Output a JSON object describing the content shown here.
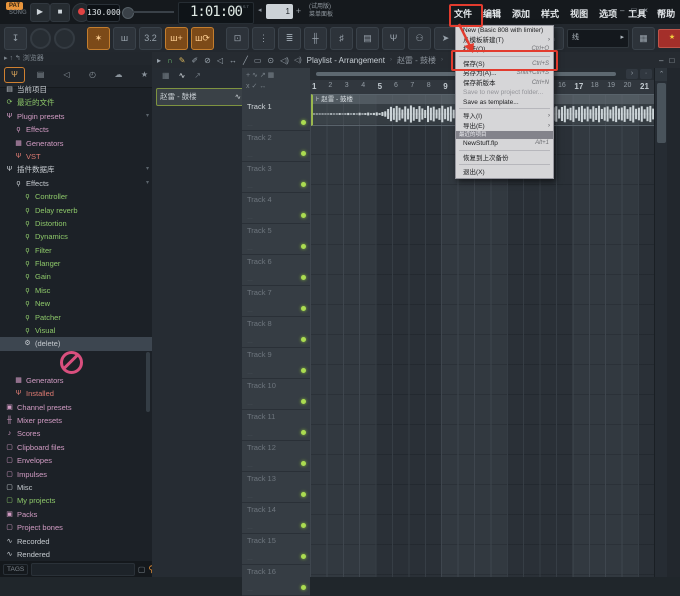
{
  "transport": {
    "mode_pat": "PAT",
    "mode_song": "SONG",
    "play_icon": "▶",
    "stop_icon": "■",
    "tempo": "130.000",
    "time": "1:01:00",
    "time_unit": "BST",
    "pattern_prev": "◂",
    "pattern_number": "1",
    "pattern_plus": "+",
    "trial_line1": "(试用版)",
    "trial_line2": "菜单面板"
  },
  "menubar": {
    "items": [
      "文件",
      "编辑",
      "添加",
      "样式",
      "视图",
      "选项",
      "工具",
      "帮助"
    ]
  },
  "window_controls": [
    "‒",
    "□",
    "×"
  ],
  "toolbar2": {
    "left_buttons": [
      {
        "name": "typing-keyboard-icon",
        "glyph": "↧"
      },
      {
        "name": "main-volume-knob",
        "knob": true
      },
      {
        "name": "main-pitch-knob",
        "knob": true
      },
      {
        "name": "metronome-icon",
        "glyph": "✶",
        "active": true
      },
      {
        "name": "wait-for-input-icon",
        "glyph": "ш"
      },
      {
        "name": "countdown-icon",
        "glyph": "3.2"
      },
      {
        "name": "blend-recording-icon",
        "glyph": "ш+",
        "active": true
      },
      {
        "name": "loop-recording-icon",
        "glyph": "ш⟳",
        "active": true
      },
      {
        "name": "step-edit-icon",
        "glyph": "⊡"
      },
      {
        "name": "piano-roll-icon",
        "glyph": "⋮"
      },
      {
        "name": "playlist-icon",
        "glyph": "≣"
      },
      {
        "name": "mixer-icon",
        "glyph": "╫"
      },
      {
        "name": "channel-rack-icon",
        "glyph": "♯"
      },
      {
        "name": "browser-icon",
        "glyph": "▤"
      },
      {
        "name": "plugin-picker-icon",
        "glyph": "Ψ"
      },
      {
        "name": "touch-icon",
        "glyph": "⚇"
      },
      {
        "name": "one-click-rec-icon",
        "glyph": "➤"
      },
      {
        "name": "undo-icon",
        "glyph": "↺"
      },
      {
        "name": "save-icon",
        "glyph": "◫"
      }
    ],
    "right": {
      "help_glyph": "?",
      "headphone_glyph": "∩",
      "line_label": "线",
      "line_arrow": "▸",
      "keyboard_glyph": "▦",
      "flag_glyph": "★",
      "arrow": "▸"
    }
  },
  "browser": {
    "header": "浏览器",
    "header_nav": "▸ ↑ ↰",
    "tabs": [
      {
        "name": "tab-plugins",
        "glyph": "Ψ",
        "active": true
      },
      {
        "name": "tab-files",
        "glyph": "▤"
      },
      {
        "name": "tab-audio",
        "glyph": "◁"
      },
      {
        "name": "tab-recent",
        "glyph": "◴"
      },
      {
        "name": "tab-cloud",
        "glyph": "☁"
      },
      {
        "name": "tab-favorites",
        "glyph": "★"
      }
    ],
    "items": [
      {
        "label": "当前项目",
        "color": "white",
        "icon": "file",
        "indent": 0
      },
      {
        "label": "最近的文件",
        "color": "green",
        "icon": "recycle",
        "indent": 0
      },
      {
        "label": "Plugin presets",
        "color": "pink",
        "icon": "plug",
        "indent": 0,
        "caret": true
      },
      {
        "label": "Effects",
        "color": "pink",
        "icon": "bulb",
        "indent": 1
      },
      {
        "label": "Generators",
        "color": "pink",
        "icon": "keys",
        "indent": 1
      },
      {
        "label": "VST",
        "color": "red",
        "icon": "plug",
        "indent": 1
      },
      {
        "label": "插件数据库",
        "color": "white",
        "icon": "plug",
        "indent": 0,
        "caret": true
      },
      {
        "label": "Effects",
        "color": "white",
        "icon": "bulb",
        "indent": 1,
        "caret": true
      },
      {
        "label": "Controller",
        "color": "green",
        "icon": "bulb",
        "indent": 2
      },
      {
        "label": "Delay reverb",
        "color": "green",
        "icon": "bulb",
        "indent": 2
      },
      {
        "label": "Distortion",
        "color": "green",
        "icon": "bulb",
        "indent": 2
      },
      {
        "label": "Dynamics",
        "color": "green",
        "icon": "bulb",
        "indent": 2
      },
      {
        "label": "Filter",
        "color": "green",
        "icon": "bulb",
        "indent": 2
      },
      {
        "label": "Flanger",
        "color": "green",
        "icon": "bulb",
        "indent": 2
      },
      {
        "label": "Gain",
        "color": "green",
        "icon": "bulb",
        "indent": 2
      },
      {
        "label": "Misc",
        "color": "green",
        "icon": "bulb",
        "indent": 2
      },
      {
        "label": "New",
        "color": "green",
        "icon": "bulb",
        "indent": 2
      },
      {
        "label": "Patcher",
        "color": "green",
        "icon": "bulb",
        "indent": 2
      },
      {
        "label": "Visual",
        "color": "green",
        "icon": "bulb",
        "indent": 2
      },
      {
        "label": "(delete)",
        "color": "white",
        "icon": "gear",
        "indent": 2,
        "selected": true,
        "nodrop": true
      },
      {
        "label": "Generators",
        "color": "pink",
        "icon": "keys",
        "indent": 1
      },
      {
        "label": "Installed",
        "color": "red",
        "icon": "plug",
        "indent": 1
      },
      {
        "label": "Channel presets",
        "color": "pink",
        "icon": "box",
        "indent": 0
      },
      {
        "label": "Mixer presets",
        "color": "pink",
        "icon": "mixer",
        "indent": 0
      },
      {
        "label": "Scores",
        "color": "pink",
        "icon": "note",
        "indent": 0
      },
      {
        "label": "Clipboard files",
        "color": "pink",
        "icon": "folder",
        "indent": 0
      },
      {
        "label": "Envelopes",
        "color": "pink",
        "icon": "folder",
        "indent": 0
      },
      {
        "label": "Impulses",
        "color": "pink",
        "icon": "folder",
        "indent": 0
      },
      {
        "label": "Misc",
        "color": "white",
        "icon": "folder",
        "indent": 0
      },
      {
        "label": "My projects",
        "color": "green",
        "icon": "folder",
        "indent": 0
      },
      {
        "label": "Packs",
        "color": "pink",
        "icon": "box",
        "indent": 0
      },
      {
        "label": "Project bones",
        "color": "pink",
        "icon": "folder",
        "indent": 0
      },
      {
        "label": "Recorded",
        "color": "white",
        "icon": "wave",
        "indent": 0
      },
      {
        "label": "Rendered",
        "color": "white",
        "icon": "wave",
        "indent": 0
      }
    ],
    "icon_glyphs": {
      "file": "▤",
      "recycle": "⟳",
      "plug": "Ψ",
      "bulb": "ϙ",
      "keys": "▦",
      "gear": "⚙",
      "box": "▣",
      "mixer": "╫",
      "note": "♪",
      "folder": "▢",
      "wave": "∿"
    },
    "tags_label": "TAGS"
  },
  "playlist": {
    "toolbar_icons": [
      {
        "name": "play-icon",
        "glyph": "▸"
      },
      {
        "name": "magnet-icon",
        "glyph": "∩",
        "color": "#6fbf73"
      },
      {
        "name": "pencil-icon",
        "glyph": "✎",
        "color": "#d8b45a"
      },
      {
        "name": "paint-icon",
        "glyph": "✐"
      },
      {
        "name": "delete-icon",
        "glyph": "⊘"
      },
      {
        "name": "mute-icon",
        "glyph": "◁"
      },
      {
        "name": "slip-icon",
        "glyph": "↔"
      },
      {
        "name": "slice-icon",
        "glyph": "╱"
      },
      {
        "name": "select-icon",
        "glyph": "▭"
      },
      {
        "name": "zoom-icon",
        "glyph": "⊙"
      },
      {
        "name": "preview-icon",
        "glyph": "◁)"
      }
    ],
    "breadcrumb_main": "Playlist - Arrangement",
    "breadcrumb_sep": "›",
    "breadcrumb_song": "赵雷 - 鼓楼",
    "window_controls": [
      "‒",
      "□",
      "×"
    ],
    "picker_tabs": [
      {
        "name": "picker-tab-patterns",
        "glyph": "▦"
      },
      {
        "name": "picker-tab-audio",
        "glyph": "∿",
        "active": true
      },
      {
        "name": "picker-tab-automation",
        "glyph": "↗"
      }
    ],
    "picker_clip": "赵雷 - 鼓楼",
    "picker_clip_icon": "∿",
    "header_tools_row1": "+  ∿ ↗ ▦",
    "header_tools_row2": "x ✓ ↔",
    "scroll_left": "‹",
    "scroll_right": "›",
    "scroll_up": "⌃",
    "tracks": [
      "Track 1",
      "Track 2",
      "Track 3",
      "Track 4",
      "Track 5",
      "Track 6",
      "Track 7",
      "Track 8",
      "Track 9",
      "Track 10",
      "Track 11",
      "Track 12",
      "Track 13",
      "Track 14",
      "Track 15",
      "Track 16"
    ],
    "ruler_bars": 22,
    "clip_name": "赵雷 - 鼓楼",
    "waveform": [
      0.05,
      0.03,
      0.04,
      0.06,
      0.03,
      0.05,
      0.08,
      0.04,
      0.06,
      0.1,
      0.05,
      0.07,
      0.12,
      0.06,
      0.09,
      0.05,
      0.14,
      0.07,
      0.1,
      0.16,
      0.08,
      0.12,
      0.18,
      0.1,
      0.22,
      0.3,
      0.55,
      0.8,
      0.65,
      0.9,
      0.7,
      0.5,
      0.85,
      0.6,
      0.95,
      0.75,
      0.55,
      0.88,
      0.62,
      0.45,
      0.9,
      0.7,
      0.82,
      0.5,
      0.65,
      0.92,
      0.58,
      0.75,
      0.85,
      0.48,
      0.7,
      0.95,
      0.6,
      0.8,
      0.52,
      0.88,
      0.66,
      0.74,
      0.9,
      0.55,
      0.68,
      0.85,
      0.5,
      0.78,
      0.92,
      0.6,
      0.72,
      0.48,
      0.86,
      0.64,
      0.9,
      0.56,
      0.76,
      0.88,
      0.52,
      0.7,
      0.94,
      0.62,
      0.8,
      0.46,
      0.84,
      0.68,
      0.9,
      0.54,
      0.74,
      0.86,
      0.5,
      0.78,
      0.92,
      0.58,
      0.7,
      0.88,
      0.48,
      0.76,
      0.9,
      0.6,
      0.82,
      0.52,
      0.86,
      0.66,
      0.92,
      0.56,
      0.74,
      0.84,
      0.5,
      0.8,
      0.9,
      0.62,
      0.72,
      0.88,
      0.54,
      0.76,
      0.94,
      0.58,
      0.7,
      0.86,
      0.52,
      0.8,
      0.9,
      0.6
    ]
  },
  "file_menu": {
    "items": [
      {
        "label": "New (Basic 808 with limiter)"
      },
      {
        "label": "从模板新建(T)",
        "submenu": true
      },
      {
        "label": "打开(O)...",
        "shortcut": "Ctrl+O"
      },
      {
        "sep": true
      },
      {
        "label": "保存(S)",
        "shortcut": "Ctrl+S",
        "annotated": true
      },
      {
        "label": "另存为(A)...",
        "shortcut": "Shift+Ctrl+S"
      },
      {
        "label": "保存新版本",
        "shortcut": "Ctrl+N"
      },
      {
        "label": "Save to new project folder...",
        "disabled": true
      },
      {
        "label": "Save as template..."
      },
      {
        "sep": true
      },
      {
        "label": "导入(I)",
        "submenu": true
      },
      {
        "label": "导出(E)",
        "submenu": true
      },
      {
        "header": "最近的项目"
      },
      {
        "label": "NewStuff.flp",
        "shortcut": "Alt+1"
      },
      {
        "sep": true
      },
      {
        "label": "恢复到上次备份"
      },
      {
        "sep": true
      },
      {
        "label": "退出(X)"
      }
    ]
  },
  "annotation_color": "#e23b2e"
}
